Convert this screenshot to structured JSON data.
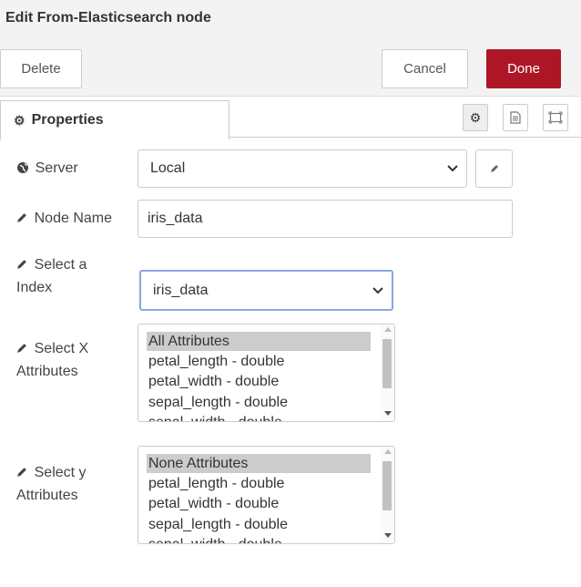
{
  "dialog": {
    "title": "Edit From-Elasticsearch node",
    "delete_label": "Delete",
    "cancel_label": "Cancel",
    "done_label": "Done",
    "done_color": "#ad1625"
  },
  "tabs": {
    "properties_label": "Properties"
  },
  "tab_icons": [
    "gear-icon",
    "description-icon",
    "frame-icon"
  ],
  "form": {
    "server": {
      "label": "Server",
      "value": "Local"
    },
    "node_name": {
      "label": "Node Name",
      "value": "iris_data"
    },
    "index": {
      "label_line1": "Select a",
      "label_line2": "Index",
      "value": "iris_data"
    },
    "x_attributes": {
      "label_line1": "Select X",
      "label_line2": "Attributes",
      "options": [
        "All Attributes",
        "petal_length - double",
        "petal_width - double",
        "sepal_length - double",
        "sepal_width - double"
      ],
      "selected": "All Attributes"
    },
    "y_attributes": {
      "label_line1": "Select y",
      "label_line2": "Attributes",
      "options": [
        "None Attributes",
        "petal_length - double",
        "petal_width - double",
        "sepal_length - double",
        "sepal_width - double"
      ],
      "selected": "None Attributes"
    }
  }
}
